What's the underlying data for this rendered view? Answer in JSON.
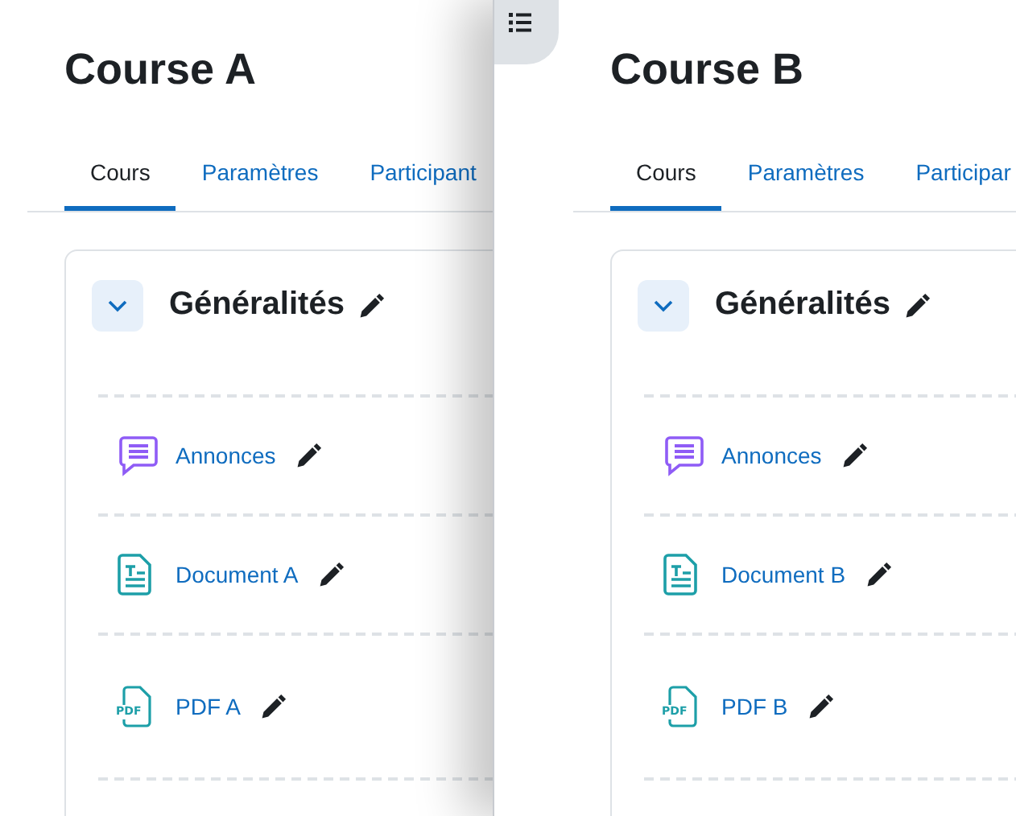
{
  "courses": [
    {
      "title": "Course A",
      "tabs": [
        {
          "label": "Cours",
          "selected": true
        },
        {
          "label": "Paramètres",
          "selected": false
        },
        {
          "label": "Participant",
          "selected": false
        }
      ],
      "section": {
        "title": "Généralités",
        "expanded": true,
        "activities": [
          {
            "kind": "forum",
            "name": "Annonces"
          },
          {
            "kind": "page",
            "name": "Document A"
          },
          {
            "kind": "pdf",
            "name": "PDF A",
            "icon_text": "PDF"
          }
        ]
      }
    },
    {
      "title": "Course B",
      "tabs": [
        {
          "label": "Cours",
          "selected": true
        },
        {
          "label": "Paramètres",
          "selected": false
        },
        {
          "label": "Participar",
          "selected": false
        }
      ],
      "section": {
        "title": "Généralités",
        "expanded": true,
        "activities": [
          {
            "kind": "forum",
            "name": "Annonces"
          },
          {
            "kind": "page",
            "name": "Document B"
          },
          {
            "kind": "pdf",
            "name": "PDF B",
            "icon_text": "PDF"
          }
        ]
      }
    }
  ]
}
